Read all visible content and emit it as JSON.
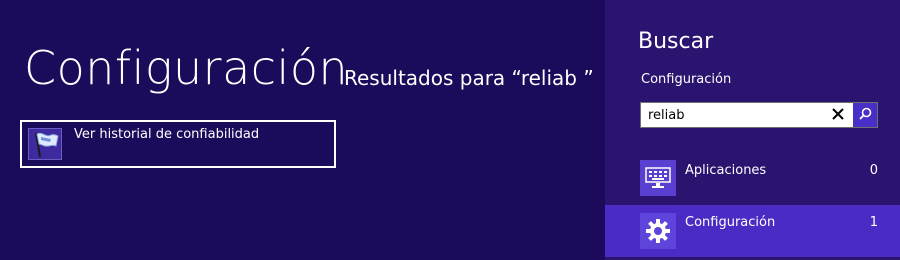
{
  "main": {
    "title": "Configuración",
    "subtitle": "Resultados para “reliab ”",
    "results": [
      {
        "label": "Ver historial de confiabilidad",
        "icon": "reliability-flag-icon"
      }
    ]
  },
  "search_pane": {
    "title": "Buscar",
    "scope_label": "Configuración",
    "query": "reliab",
    "clear_icon": "close-icon",
    "search_icon": "search-icon",
    "categories": [
      {
        "label": "Aplicaciones",
        "count": "0",
        "icon": "keyboard-icon",
        "selected": false
      },
      {
        "label": "Configuración",
        "count": "1",
        "icon": "gear-icon",
        "selected": true
      }
    ]
  },
  "colors": {
    "background": "#1c0a5a",
    "pane": "#2a1470",
    "accent": "#4a2cc4"
  }
}
